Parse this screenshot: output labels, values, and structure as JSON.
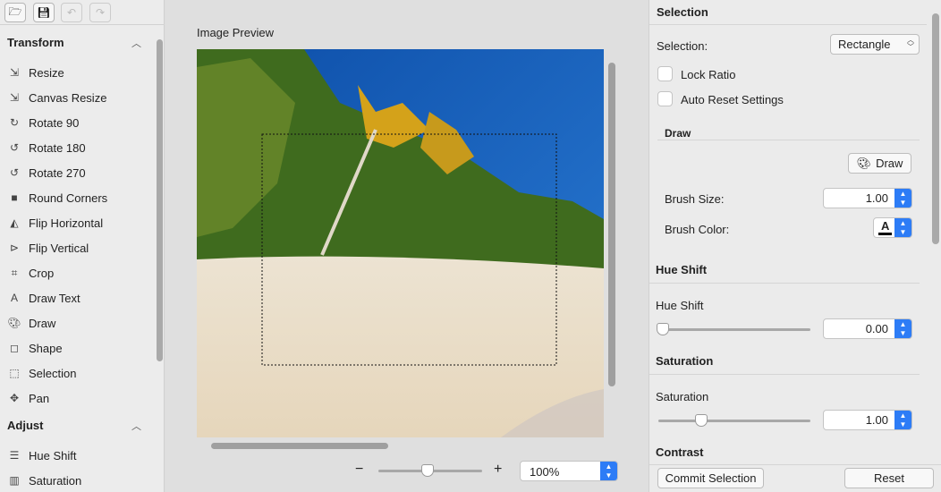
{
  "toolbar": {
    "icons": [
      "open-folder-icon",
      "save-icon",
      "undo-icon",
      "redo-icon"
    ]
  },
  "sidebar": {
    "sections": [
      {
        "title": "Transform",
        "items": [
          {
            "label": "Resize",
            "icon": "resize-icon"
          },
          {
            "label": "Canvas Resize",
            "icon": "canvas-resize-icon"
          },
          {
            "label": "Rotate 90",
            "icon": "rotate-90-icon"
          },
          {
            "label": "Rotate 180",
            "icon": "rotate-180-icon"
          },
          {
            "label": "Rotate 270",
            "icon": "rotate-270-icon"
          },
          {
            "label": "Round Corners",
            "icon": "round-corners-icon"
          },
          {
            "label": "Flip Horizontal",
            "icon": "flip-horizontal-icon"
          },
          {
            "label": "Flip Vertical",
            "icon": "flip-vertical-icon"
          },
          {
            "label": "Crop",
            "icon": "crop-icon"
          },
          {
            "label": "Draw Text",
            "icon": "draw-text-icon"
          },
          {
            "label": "Draw",
            "icon": "palette-icon"
          },
          {
            "label": "Shape",
            "icon": "shape-icon"
          },
          {
            "label": "Selection",
            "icon": "selection-icon"
          },
          {
            "label": "Pan",
            "icon": "pan-icon"
          }
        ]
      },
      {
        "title": "Adjust",
        "items": [
          {
            "label": "Hue Shift",
            "icon": "sliders-icon"
          },
          {
            "label": "Saturation",
            "icon": "saturation-icon"
          }
        ]
      }
    ]
  },
  "preview": {
    "title": "Image Preview",
    "zoom": "100%",
    "zoom_slider_fraction": 0.47,
    "minus": "−",
    "plus": "+"
  },
  "panel": {
    "selection_header": "Selection",
    "selection_label": "Selection:",
    "selection_value": "Rectangle",
    "lock_ratio": "Lock Ratio",
    "auto_reset": "Auto Reset Settings",
    "draw_header": "Draw",
    "draw_button": "Draw",
    "brush_size_label": "Brush Size:",
    "brush_size": "1.00",
    "brush_color_label": "Brush Color:",
    "brush_color_glyph": "A",
    "hue_header": "Hue Shift",
    "hue_label": "Hue Shift",
    "hue_value": "0.00",
    "hue_fraction": 0.0,
    "sat_header": "Saturation",
    "sat_label": "Saturation",
    "sat_value": "1.00",
    "sat_fraction": 0.25,
    "contrast_header": "Contrast",
    "commit": "Commit Selection",
    "reset": "Reset"
  },
  "colors": {
    "accent": "#2d7cf6",
    "sky": "#1558b8"
  }
}
